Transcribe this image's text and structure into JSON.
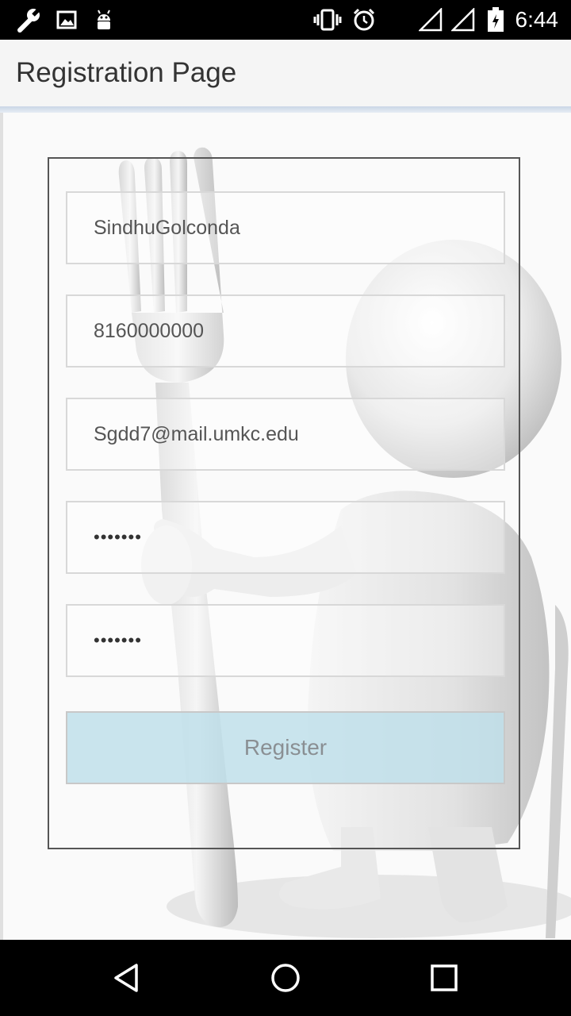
{
  "status_bar": {
    "time": "6:44",
    "left_icons": [
      "wrench-icon",
      "image-icon",
      "android-icon"
    ],
    "right_icons": [
      "vibrate-icon",
      "alarm-icon",
      "signal-icon",
      "signal-icon",
      "battery-icon"
    ]
  },
  "app_bar": {
    "title": "Registration Page"
  },
  "form": {
    "name_value": "SindhuGolconda",
    "phone_value": "8160000000",
    "email_value": "Sgdd7@mail.umkc.edu",
    "password_value": "•••••••",
    "confirm_password_value": "•••••••",
    "register_label": "Register"
  },
  "nav_bar": {
    "buttons": [
      "back-icon",
      "home-icon",
      "recents-icon"
    ]
  }
}
